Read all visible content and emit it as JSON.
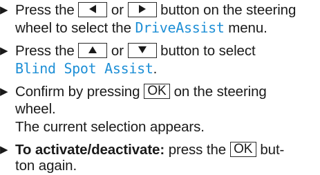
{
  "steps": [
    {
      "line1": {
        "a": "Press the",
        "b": "or",
        "c": "button on the steering"
      },
      "line2": {
        "a": "wheel to select the",
        "menu": "DriveAssist",
        "b": "menu."
      },
      "keys": [
        "left-arrow",
        "right-arrow"
      ]
    },
    {
      "line1": {
        "a": "Press the",
        "b": "or",
        "c": "button to select"
      },
      "line2": {
        "menu": "Blind Spot Assist",
        "period": "."
      },
      "keys": [
        "up-arrow",
        "down-arrow"
      ]
    },
    {
      "line1": {
        "a": "Confirm by pressing",
        "key": "OK",
        "b": "on the steering"
      },
      "line2": {
        "a": "wheel."
      },
      "line3": "The current selection appears."
    },
    {
      "line1": {
        "bold": "To activate/deactivate:",
        "a": "press the",
        "key": "OK",
        "b": "but-"
      },
      "line2": {
        "a": "ton again."
      }
    }
  ],
  "colors": {
    "menu_text": "#1e8fd6",
    "body_text": "#1a1a1a",
    "key_border": "#2a2a2a"
  },
  "bullet_glyph": "▶"
}
